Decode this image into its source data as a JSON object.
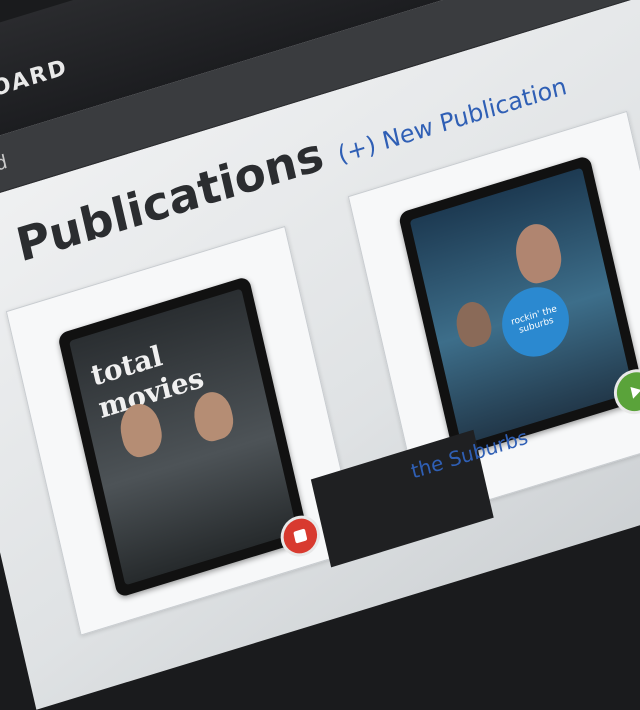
{
  "topbar": {
    "brand": "SHBOARD"
  },
  "breadcrumb": "board",
  "main": {
    "title": "y Publications",
    "new_publication_label": "(+) New Publication",
    "publications": [
      {
        "cover_title": "total movies"
      },
      {
        "cover_badge": "rockin' the suburbs",
        "link_label": "the Suburbs"
      }
    ]
  }
}
